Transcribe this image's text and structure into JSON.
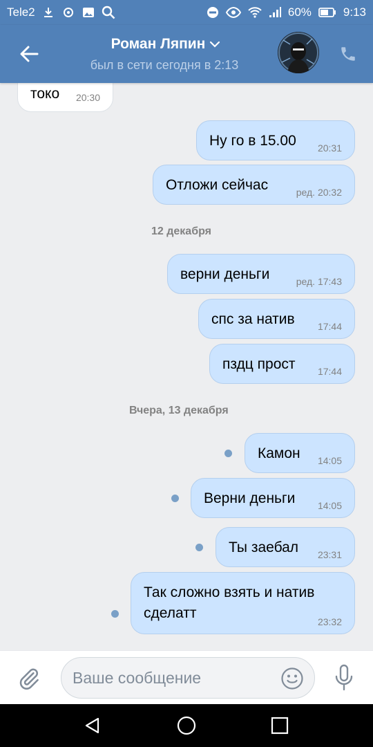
{
  "status_bar": {
    "carrier": "Tele2",
    "battery_percent": "60%",
    "time": "9:13",
    "icons": [
      "download-icon",
      "vk-notification-icon",
      "image-icon",
      "search-icon",
      "dnd-icon",
      "eye-icon",
      "wifi-icon",
      "signal-icon",
      "battery-icon"
    ]
  },
  "header": {
    "contact_name": "Роман Ляпин",
    "last_seen": "был в сети сегодня в 2:13",
    "colors": {
      "bar": "#5181b8",
      "subtitle": "#bcd0e8"
    }
  },
  "messages": [
    {
      "dir": "in",
      "text": "токо",
      "time": "20:30"
    },
    {
      "dir": "out",
      "text": "Ну го в 15.00",
      "time": "20:31"
    },
    {
      "dir": "out",
      "text": "Отложи сейчас",
      "time": "ред. 20:32"
    },
    {
      "type": "date",
      "text": "12 декабря"
    },
    {
      "dir": "out",
      "text": "верни деньги",
      "time": "ред. 17:43"
    },
    {
      "dir": "out",
      "text": "спс за натив",
      "time": "17:44"
    },
    {
      "dir": "out",
      "text": "пздц прост",
      "time": "17:44"
    },
    {
      "type": "date",
      "text": "Вчера, 13 декабря"
    },
    {
      "dir": "out",
      "text": "Камон",
      "time": "14:05",
      "unread": true
    },
    {
      "dir": "out",
      "text": "Верни деньги",
      "time": "14:05",
      "unread": true
    },
    {
      "dir": "out",
      "text": "Ты заебал",
      "time": "23:31",
      "unread": true
    },
    {
      "dir": "out",
      "text_line1": "Так сложно взять и натив",
      "text_line2": "сделатт",
      "time": "23:32",
      "unread": true
    }
  ],
  "composer": {
    "placeholder": "Ваше сообщение"
  },
  "colors": {
    "outgoing_bubble": "#cce4ff",
    "incoming_bubble": "#ffffff",
    "background": "#edeef0",
    "unread_dot": "#7aa0c7"
  }
}
